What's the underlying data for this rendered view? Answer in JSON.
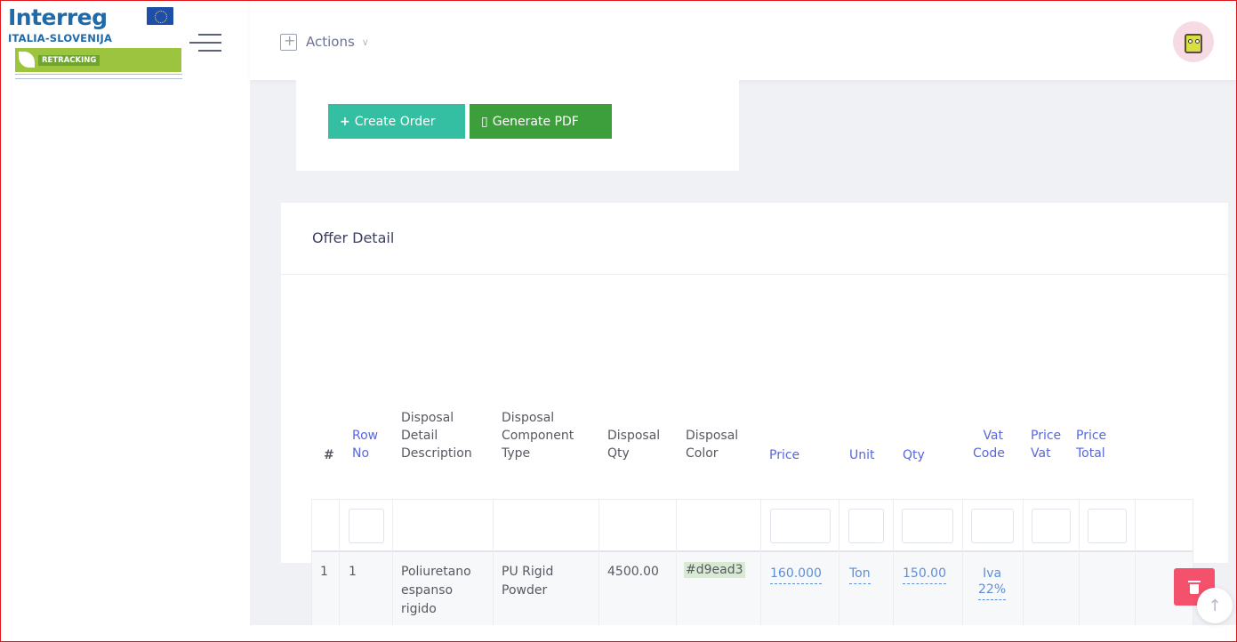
{
  "logo": {
    "brand": "Interreg",
    "country": "ITALIA-SLOVENIJA",
    "project": "RETRACKING"
  },
  "header": {
    "actions_label": "Actions"
  },
  "buttons": {
    "create_order": "Create Order",
    "generate_pdf": "Generate PDF"
  },
  "offer": {
    "title": "Offer Detail",
    "columns": [
      {
        "key": "hash",
        "label": "#"
      },
      {
        "key": "row_no",
        "label": "Row No"
      },
      {
        "key": "desc",
        "label": "Disposal Detail Description"
      },
      {
        "key": "comp",
        "label": "Disposal Component Type"
      },
      {
        "key": "dqty",
        "label": "Disposal Qty"
      },
      {
        "key": "color",
        "label": "Disposal Color"
      },
      {
        "key": "price",
        "label": "Price"
      },
      {
        "key": "unit",
        "label": "Unit"
      },
      {
        "key": "qty",
        "label": "Qty"
      },
      {
        "key": "vat",
        "label": "Vat Code"
      },
      {
        "key": "pvat",
        "label": "Price Vat"
      },
      {
        "key": "ptot",
        "label": "Price Total"
      }
    ],
    "header_lines": {
      "row_no": [
        "Row",
        "No"
      ],
      "desc": [
        "Disposal",
        "Detail",
        "Description"
      ],
      "comp": [
        "Disposal",
        "Component",
        "Type"
      ],
      "dqty": [
        "Disposal",
        "Qty"
      ],
      "color": [
        "Disposal",
        "Color"
      ],
      "vat": [
        "Vat",
        "Code"
      ],
      "pvat": [
        "Price",
        "Vat"
      ],
      "ptot": [
        "Price",
        "Total"
      ]
    },
    "rows": [
      {
        "index": "1",
        "row_no": "1",
        "desc_lines": [
          "Poliuretano",
          "espanso",
          "rigido"
        ],
        "comp_lines": [
          "PU Rigid",
          "Powder"
        ],
        "dqty": "4500.00",
        "color": "#d9ead3",
        "price": "160.000",
        "unit": "Ton",
        "qty": "150.00",
        "vat_lines": [
          "Iva",
          "22%"
        ],
        "pvat": "",
        "ptot": ""
      }
    ]
  },
  "colors": {
    "accent_teal": "#34bfa3",
    "accent_green": "#3c9f3c",
    "danger": "#f4516c",
    "link_blue": "#5d8fd6",
    "header_blue": "#5867dd"
  },
  "icons": {
    "menu": "hamburger-icon",
    "actions": "plus-square-icon",
    "create": "plus-icon",
    "pdf": "pdf-file-icon",
    "delete": "trash-icon",
    "scroll": "arrow-up-icon"
  }
}
